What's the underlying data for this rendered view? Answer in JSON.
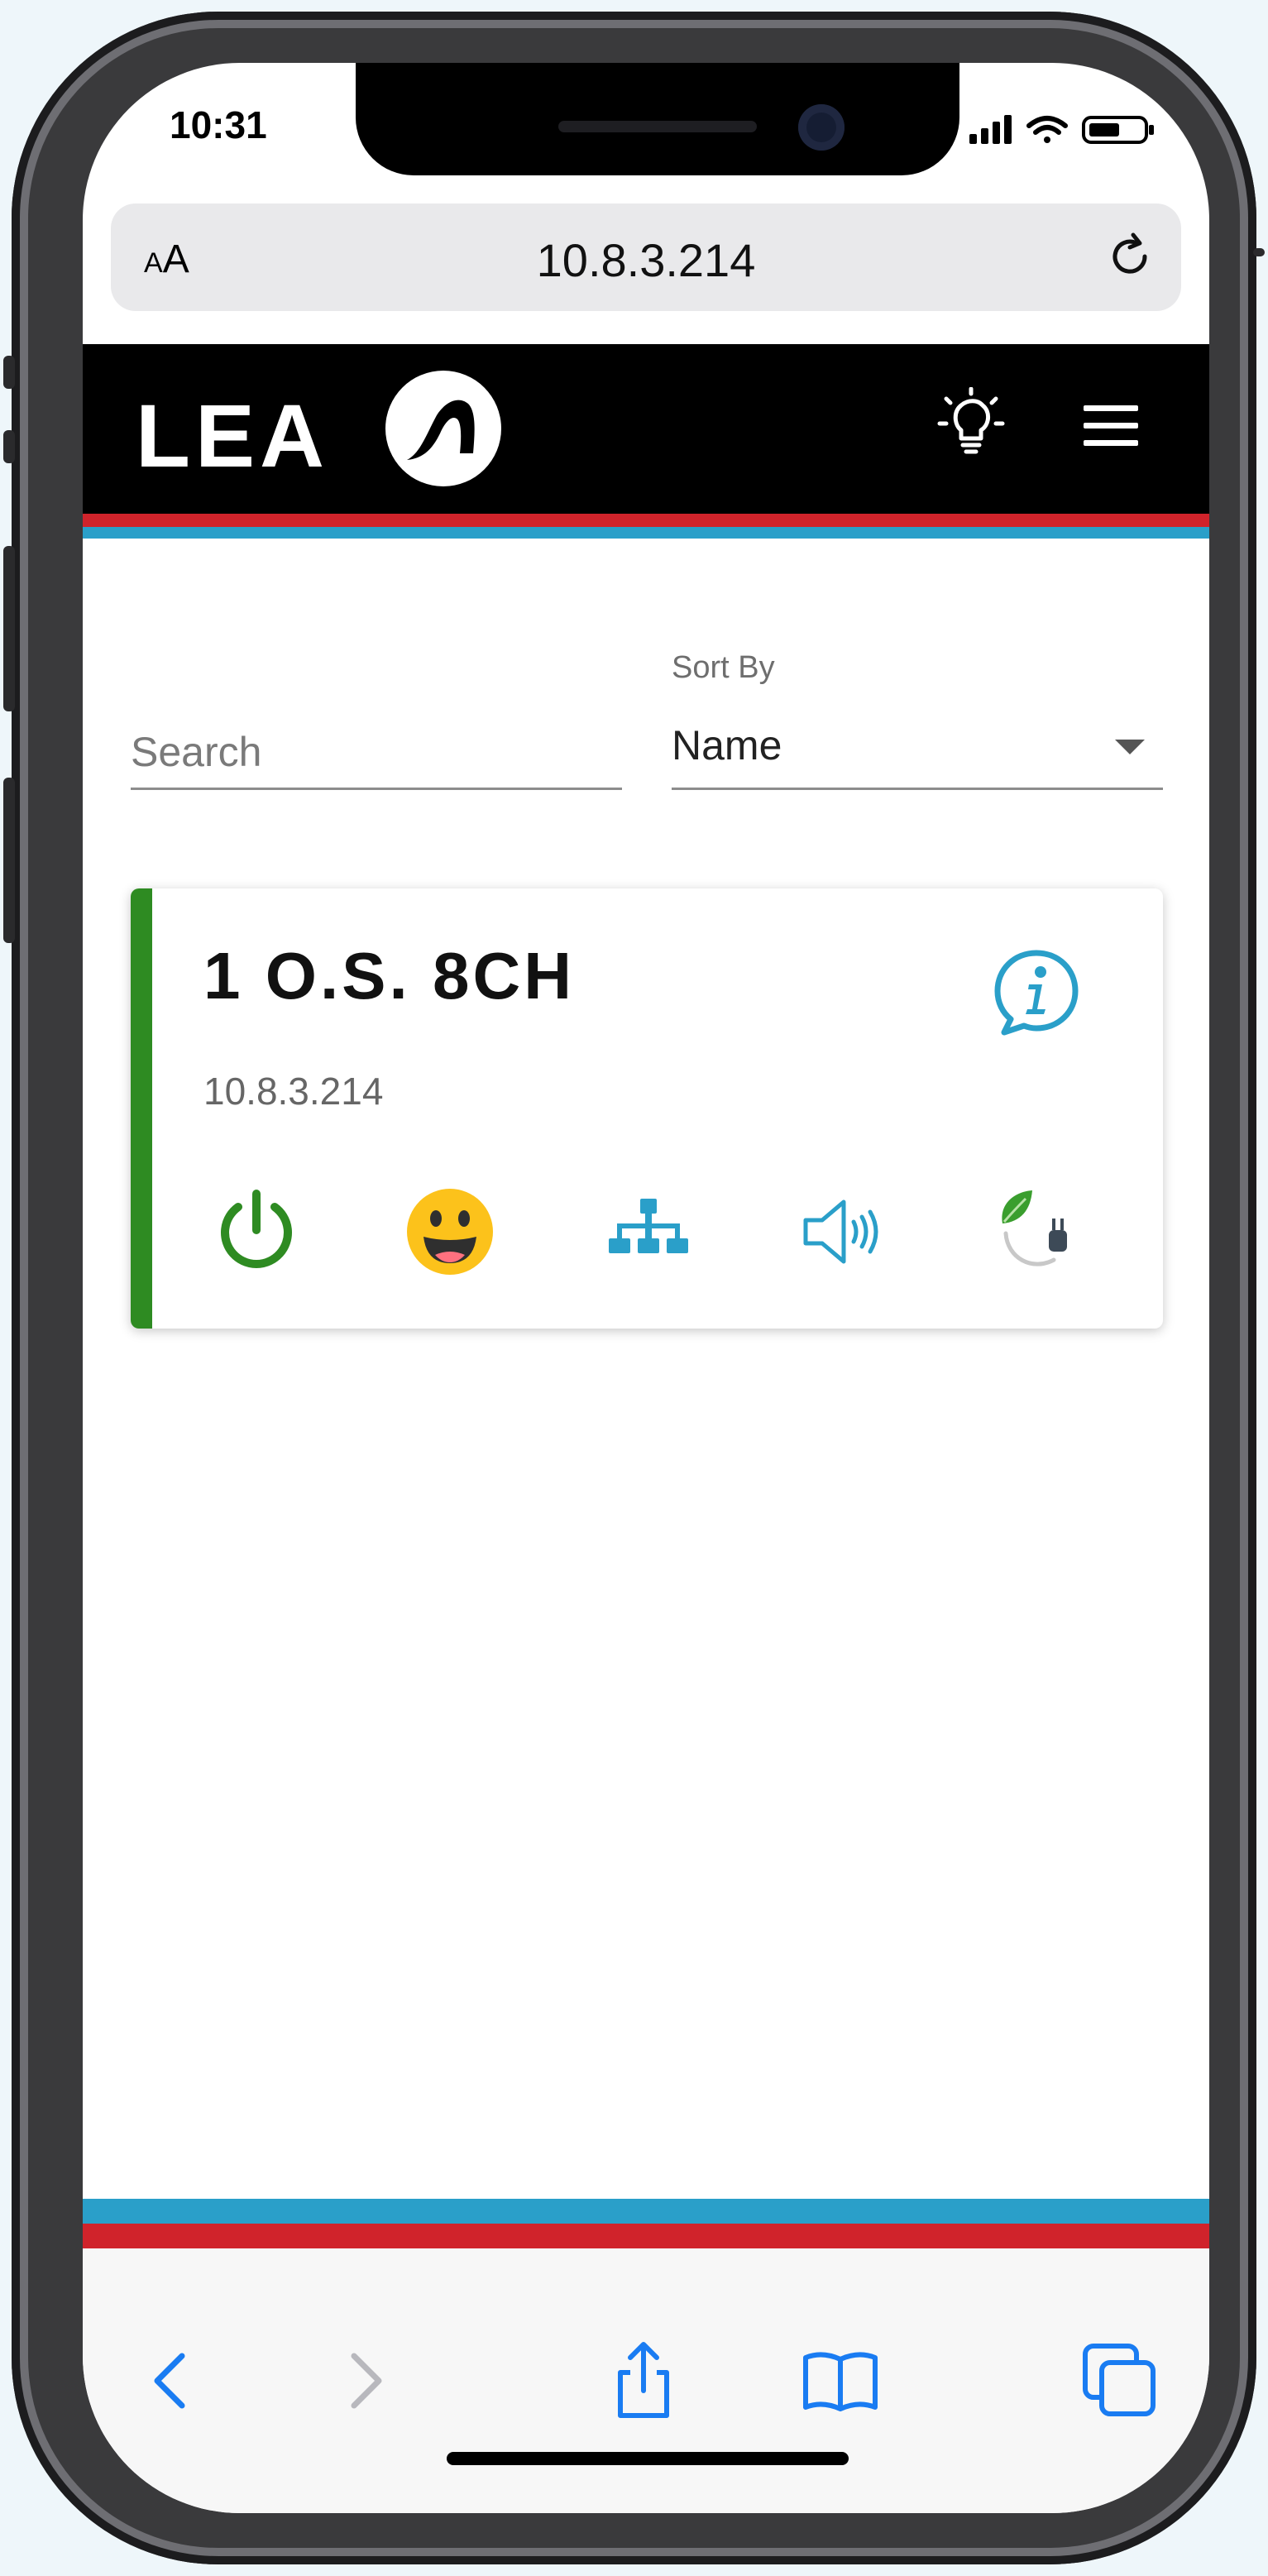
{
  "status_bar": {
    "time": "10:31",
    "icons": [
      "signal-icon",
      "wifi-icon",
      "battery-icon"
    ]
  },
  "browser": {
    "text_size_label": "AA",
    "url": "10.8.3.214",
    "reload_icon": "reload-icon"
  },
  "header": {
    "brand": "LEA",
    "background": "#000000",
    "stripe_colors": [
      "#d0232b",
      "#2a9fc9"
    ],
    "icons": [
      "lightbulb-icon",
      "hamburger-menu-icon"
    ]
  },
  "filters": {
    "search_placeholder": "Search",
    "sort_label": "Sort By",
    "sort_value": "Name"
  },
  "devices": [
    {
      "name": "1 O.S. 8CH",
      "ip": "10.8.3.214",
      "status_color": "#2e8b22",
      "icons": [
        "power-icon",
        "smiley-face-icon",
        "network-icon",
        "speaker-icon",
        "eco-power-plug-icon"
      ],
      "info_icon": "info-icon"
    }
  ],
  "toolbar": {
    "icons": [
      "back-icon",
      "forward-icon",
      "share-icon",
      "bookmarks-icon",
      "tabs-icon"
    ]
  },
  "colors": {
    "accent_blue": "#2a9fc9",
    "accent_red": "#d0232b",
    "status_green": "#2e8b22",
    "ios_blue": "#1a7cf2"
  }
}
